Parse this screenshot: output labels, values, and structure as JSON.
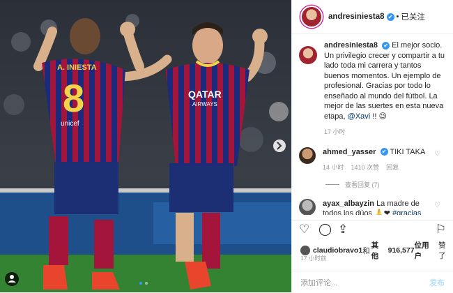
{
  "post": {
    "username": "andresiniesta8",
    "follow_label": "已关注",
    "verified_glyph": "✔",
    "caption": {
      "username": "andresiniesta8",
      "text_before_mention": "El mejor socio. Un privilegio crecer y compartir a tu lado toda mi carrera y tantos buenos momentos. Un ejemplo de profesional. Gracias por todo lo enseñado al mundo del fútbol. La mejor de las suertes en esta nueva etapa,",
      "mention": "@Xavi",
      "text_after": "!! 😉",
      "time": "17 小时"
    },
    "comments": [
      {
        "username": "ahmed_yasser",
        "text": "TIKI TAKA",
        "time": "14 小时",
        "likes": "1410 次赞",
        "reply": "回复",
        "view_replies": "查看回复 (7)"
      },
      {
        "username": "ayax_albayzin",
        "text": "La madre de todos los dúos 🙏❤",
        "hashtag": "#gracias"
      }
    ],
    "likes": {
      "username": "claudiobravo1",
      "and": "和",
      "others": "其他",
      "count": "916,577",
      "unit": "位用户",
      "suffix": "赞了"
    },
    "time_ago": "17 小时前",
    "add_comment_placeholder": "添加评论...",
    "post_label": "发布",
    "photo": {
      "player1_name": "A. INIESTA",
      "player1_number": "8",
      "sponsor1": "unicef",
      "sponsor2": "QATAR",
      "sponsor2_sub": "AIRWAYS"
    }
  }
}
